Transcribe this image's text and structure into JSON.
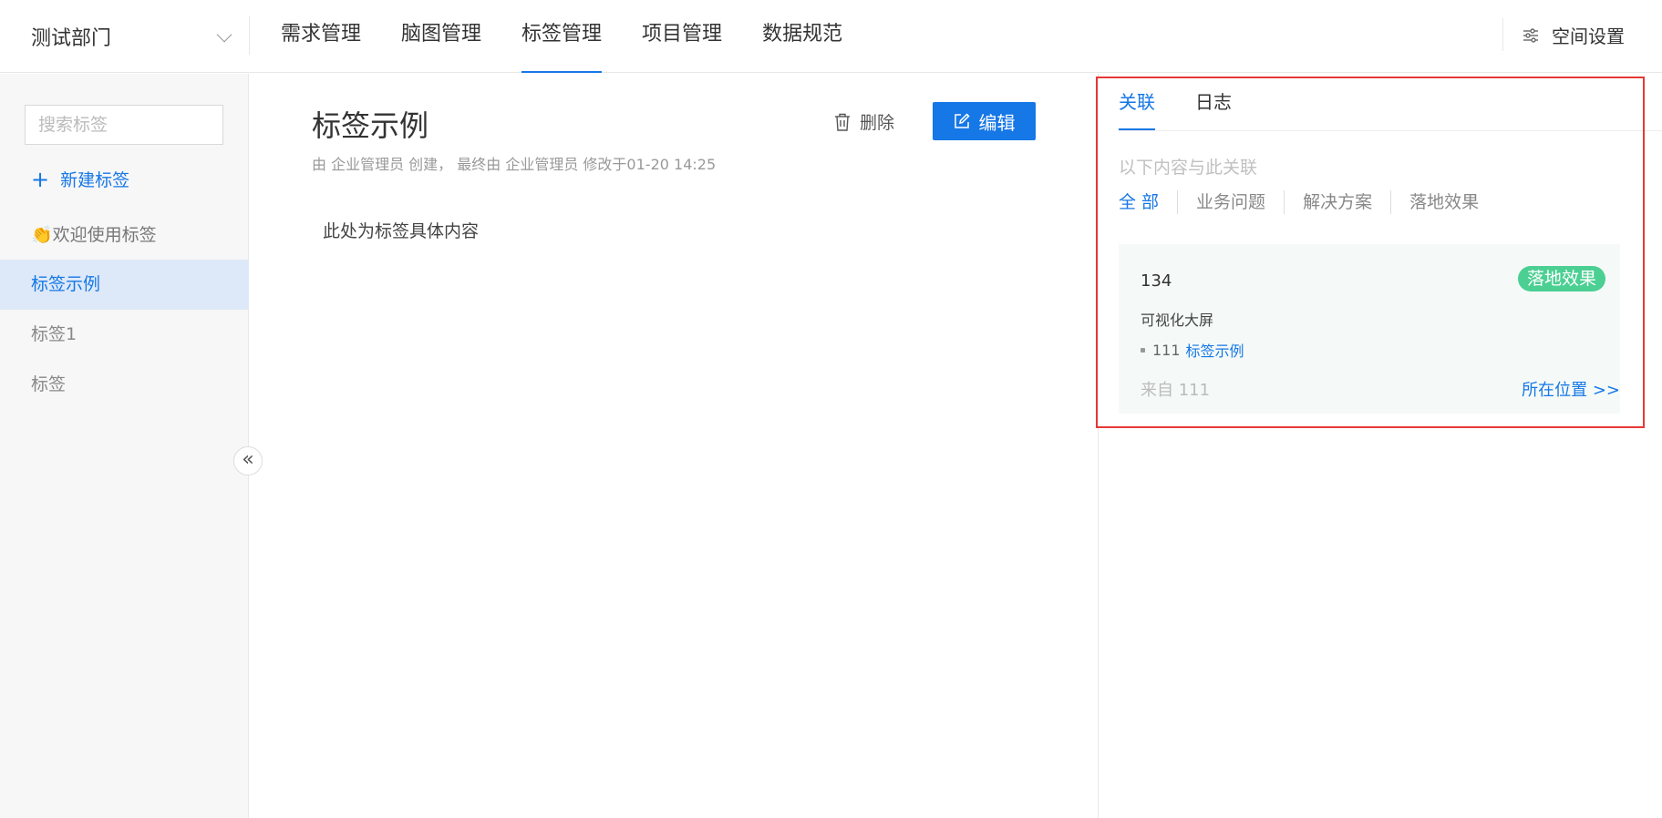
{
  "header": {
    "department": "测试部门",
    "nav": [
      "需求管理",
      "脑图管理",
      "标签管理",
      "项目管理",
      "数据规范"
    ],
    "active_nav_index": 2,
    "space_settings": "空间设置"
  },
  "sidebar": {
    "search_placeholder": "搜索标签",
    "new_tag": "新建标签",
    "welcome": "👏欢迎使用标签",
    "items": [
      "标签示例",
      "标签1",
      "标签"
    ],
    "active_item_index": 0
  },
  "main": {
    "title": "标签示例",
    "meta": "由 企业管理员 创建， 最终由 企业管理员 修改于01-20 14:25",
    "delete_label": "删除",
    "edit_label": "编辑",
    "content": "此处为标签具体内容"
  },
  "right_panel": {
    "tabs": [
      "关联",
      "日志"
    ],
    "active_tab_index": 0,
    "description": "以下内容与此关联",
    "filters": [
      "全 部",
      "业务问题",
      "解决方案",
      "落地效果"
    ],
    "active_filter_index": 0,
    "card": {
      "number": "134",
      "badge": "落地效果",
      "name": "可视化大屏",
      "relation_prefix": "111",
      "relation_link": "标签示例",
      "from": "来自 111",
      "location_link": "所在位置 >>"
    }
  },
  "colors": {
    "accent": "#1677e6",
    "badge_green": "#4ccf93",
    "highlight_box": "#e53935",
    "sidebar_active_bg": "#dde9f8"
  }
}
